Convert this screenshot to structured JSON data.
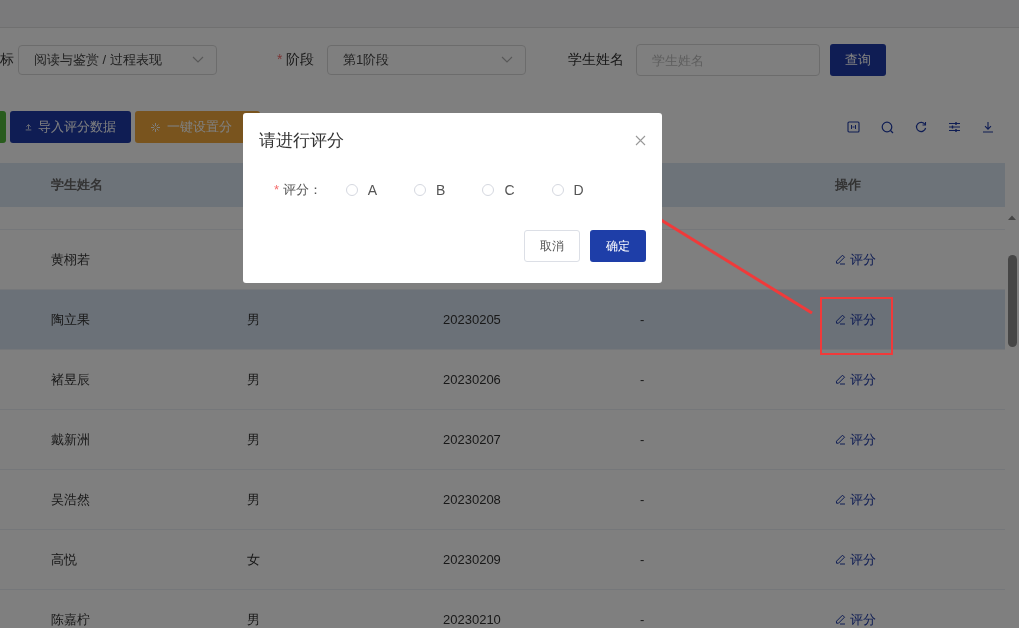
{
  "top_filters": {
    "partial_label": "标",
    "category_select": {
      "value": "阅读与鉴赏 / 过程表现"
    },
    "stage": {
      "required_mark": "*",
      "label": "阶段",
      "value": "第1阶段"
    },
    "name_filter": {
      "label": "学生姓名",
      "placeholder": "学生姓名"
    },
    "query_button": "查询"
  },
  "toolbar": {
    "buttons": [
      {
        "kind": "import",
        "label": "导入评分数据"
      },
      {
        "kind": "batch",
        "label": "一键设置分"
      }
    ]
  },
  "table": {
    "columns": {
      "column_1": "学生姓名",
      "column_5": "操作"
    },
    "rows": [
      {
        "name": "黄栩若",
        "action": "评分",
        "hovered": false
      },
      {
        "name": "陶立果",
        "gender": "男",
        "student_id": "20230205",
        "score": "-",
        "action": "评分",
        "hovered": true
      },
      {
        "name": "褚昱辰",
        "gender": "男",
        "student_id": "20230206",
        "score": "-",
        "action": "评分",
        "hovered": false
      },
      {
        "name": "戴新洲",
        "gender": "男",
        "student_id": "20230207",
        "score": "-",
        "action": "评分",
        "hovered": false
      },
      {
        "name": "吴浩然",
        "gender": "男",
        "student_id": "20230208",
        "score": "-",
        "action": "评分",
        "hovered": false
      },
      {
        "name": "高悦",
        "gender": "女",
        "student_id": "20230209",
        "score": "-",
        "action": "评分",
        "hovered": false
      },
      {
        "name": "陈嘉柠",
        "gender": "男",
        "student_id": "20230210",
        "score": "-",
        "action": "评分",
        "hovered": false
      }
    ]
  },
  "dialog": {
    "title": "请进行评分",
    "field": {
      "required_mark": "*",
      "label": "评分：",
      "options": [
        {
          "label": "A",
          "selected": false
        },
        {
          "label": "B",
          "selected": false
        },
        {
          "label": "C",
          "selected": false
        },
        {
          "label": "D",
          "selected": false
        }
      ]
    },
    "buttons": [
      {
        "kind": "cancel",
        "label": "取消"
      },
      {
        "kind": "confirm",
        "label": "确定"
      }
    ]
  }
}
